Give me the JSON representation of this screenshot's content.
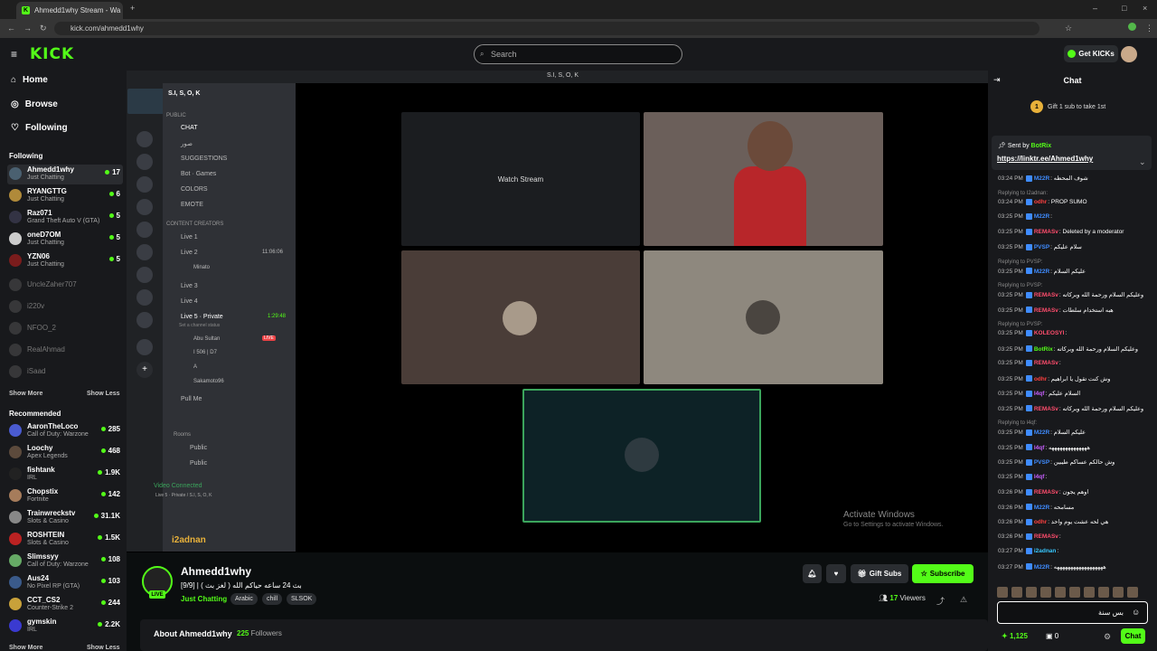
{
  "browser": {
    "tab_title": "Ahmedd1why Stream - Wa",
    "url": "kick.com/ahmedd1why"
  },
  "header": {
    "logo": "KICK",
    "search_placeholder": "Search",
    "get_kicks": "Get KICKs"
  },
  "sidebar": {
    "nav": [
      {
        "label": "Home",
        "icon": "home-icon"
      },
      {
        "label": "Browse",
        "icon": "compass-icon"
      },
      {
        "label": "Following",
        "icon": "heart-icon"
      }
    ],
    "following_title": "Following",
    "following": [
      {
        "name": "Ahmedd1why",
        "category": "Just Chatting",
        "viewers": "17"
      },
      {
        "name": "RYANGTTG",
        "category": "Just Chatting",
        "viewers": "6"
      },
      {
        "name": "Raz071",
        "category": "Grand Theft Auto V (GTA)",
        "viewers": "5"
      },
      {
        "name": "oneD7OM",
        "category": "Just Chatting",
        "viewers": "5"
      },
      {
        "name": "YZN06",
        "category": "Just Chatting",
        "viewers": "5"
      },
      {
        "name": "UncleZaher707"
      },
      {
        "name": "i220v"
      },
      {
        "name": "NFOO_2"
      },
      {
        "name": "RealAhmad"
      },
      {
        "name": "iSaad"
      }
    ],
    "show_more": "Show More",
    "show_less": "Show Less",
    "recommended_title": "Recommended",
    "recommended": [
      {
        "name": "AaronTheLoco",
        "category": "Call of Duty: Warzone",
        "viewers": "285"
      },
      {
        "name": "Loochy",
        "category": "Apex Legends",
        "viewers": "468"
      },
      {
        "name": "fishtank",
        "category": "IRL",
        "viewers": "1.9K"
      },
      {
        "name": "Chopstix",
        "category": "Fortnite",
        "viewers": "142"
      },
      {
        "name": "Trainwreckstv",
        "category": "Slots & Casino",
        "viewers": "31.1K"
      },
      {
        "name": "ROSHTEIN",
        "category": "Slots & Casino",
        "viewers": "1.5K"
      },
      {
        "name": "Slimssyy",
        "category": "Call of Duty: Warzone",
        "viewers": "108"
      },
      {
        "name": "Aus24",
        "category": "No Pixel RP (GTA)",
        "viewers": "103"
      },
      {
        "name": "CCT_CS2",
        "category": "Counter-Strike 2",
        "viewers": "244"
      },
      {
        "name": "gymskin",
        "category": "IRL",
        "viewers": "2.2K"
      }
    ],
    "show_more_2": "Show More",
    "show_less_2": "Show Less"
  },
  "stream": {
    "discord_title": "S.I, S, O, K",
    "server_name": "S.I, S, O, K",
    "public_cat": "PUBLIC",
    "channels": [
      "CHAT",
      "صور",
      "SUGGESTIONS",
      "Bot · Games",
      "COLORS",
      "EMOTE"
    ],
    "content_cat": "CONTENT CREATORS",
    "voice": [
      "Live 1",
      "Live 2",
      "Minato",
      "Live 3",
      "Live 4",
      "Live 5 · Private",
      "Set a channel status",
      "Abu Sultan",
      "I 506 | D7",
      "A",
      "Sakamoto96",
      "Pull Me",
      "Rooms",
      "Public",
      "Public"
    ],
    "live2_time": "11:06:06",
    "live5_time": "1:29:48",
    "live_badge": "LIVE",
    "voice_connected": "Video Connected",
    "voice_sub": "Live 5 · Private / S.I, S, O, K",
    "user": "i2adnan",
    "watch_stream": "Watch Stream",
    "activate1": "Activate Windows",
    "activate2": "Go to Settings to activate Windows."
  },
  "channel": {
    "name": "Ahmedd1why",
    "live": "LIVE",
    "title": "بث 24 ساعه حياكم الله ( لغز بث ) | [9/9]",
    "category": "Just Chatting",
    "tags": [
      "Arabic",
      "chill",
      "SLSOK"
    ],
    "gift_subs": "Gift Subs",
    "subscribe": "Subscribe",
    "viewers": "17",
    "viewers_label": "Viewers",
    "about": "About Ahmedd1why",
    "followers": "225",
    "followers_label": "Followers"
  },
  "chat": {
    "title": "Chat",
    "gift_rank": "1",
    "gift_text": "Gift 1 sub to take 1st",
    "pinned_by": "Sent by",
    "pinned_user": "BotRix",
    "pinned_link": "https://linktr.ee/Ahmed1why",
    "messages": [
      {
        "time": "03:24 PM",
        "user": "M22R",
        "color": "#3f8cff",
        "text": "شوف المحظه"
      },
      {
        "reply": "Replying to I2adnan:"
      },
      {
        "time": "03:24 PM",
        "user": "odhr",
        "color": "#ff4040",
        "text": "PROP SUMO"
      },
      {
        "time": "03:25 PM",
        "user": "M22R",
        "color": "#3f8cff",
        "text": ""
      },
      {
        "time": "03:25 PM",
        "user": "REMASv",
        "color": "#ff4d6d",
        "text": "Deleted by a moderator"
      },
      {
        "time": "03:25 PM",
        "user": "PVSP",
        "color": "#3f8cff",
        "text": "سلام عليكم"
      },
      {
        "reply": "Replying to PVSP:"
      },
      {
        "time": "03:25 PM",
        "user": "M22R",
        "color": "#3f8cff",
        "text": "عليكم السلام"
      },
      {
        "reply": "Replying to PVSP:"
      },
      {
        "time": "03:25 PM",
        "user": "REMASv",
        "color": "#ff4d6d",
        "text": "وعليكم السلام ورحمة الله وبركاته"
      },
      {
        "time": "03:25 PM",
        "user": "REMASv",
        "color": "#ff4d6d",
        "text": "هبه استخدام سلطات"
      },
      {
        "reply": "Replying to PVSP:"
      },
      {
        "time": "03:25 PM",
        "user": "KOLEOSYI",
        "color": "#ff4d6d",
        "text": ""
      },
      {
        "time": "03:25 PM",
        "user": "BotRix",
        "color": "#53fc18",
        "text": "وعليكم السلام ورحمة الله وبركاته"
      },
      {
        "time": "03:25 PM",
        "user": "REMASv",
        "color": "#ff4d6d",
        "text": ""
      },
      {
        "time": "03:25 PM",
        "user": "odhr",
        "color": "#ff4040",
        "text": "وش كنت تقول يا ابراهيم"
      },
      {
        "time": "03:25 PM",
        "user": "l4qf",
        "color": "#c860ff",
        "text": "السلام عليكم"
      },
      {
        "time": "03:25 PM",
        "user": "REMASv",
        "color": "#ff4d6d",
        "text": "وعليكم السلام ورحمة الله وبركاته"
      },
      {
        "reply": "Replying to l4qf:"
      },
      {
        "time": "03:25 PM",
        "user": "M22R",
        "color": "#3f8cff",
        "text": "عليكم السلام"
      },
      {
        "time": "03:25 PM",
        "user": "l4qf",
        "color": "#c860ff",
        "text": "ههههههههههههههه"
      },
      {
        "time": "03:25 PM",
        "user": "PVSP",
        "color": "#3f8cff",
        "text": "وش حالكم عساكم طيبين"
      },
      {
        "time": "03:25 PM",
        "user": "l4qf",
        "color": "#c860ff",
        "text": ""
      },
      {
        "time": "03:26 PM",
        "user": "REMASv",
        "color": "#ff4d6d",
        "text": "اوهم يجون"
      },
      {
        "time": "03:26 PM",
        "user": "M22R",
        "color": "#3f8cff",
        "text": "مسامحه"
      },
      {
        "time": "03:26 PM",
        "user": "odhr",
        "color": "#ff4040",
        "text": "هي لحه عشت يوم واحد"
      },
      {
        "time": "03:26 PM",
        "user": "REMASv",
        "color": "#ff4d6d",
        "text": ""
      },
      {
        "time": "03:27 PM",
        "user": "i2adnan",
        "color": "#37c8ff",
        "text": ""
      },
      {
        "time": "03:27 PM",
        "user": "M22R",
        "color": "#3f8cff",
        "text": "ههههههههههههههههههه"
      }
    ],
    "input_value": "بس سنة",
    "points": "1,125",
    "zero": "0",
    "send": "Chat"
  }
}
